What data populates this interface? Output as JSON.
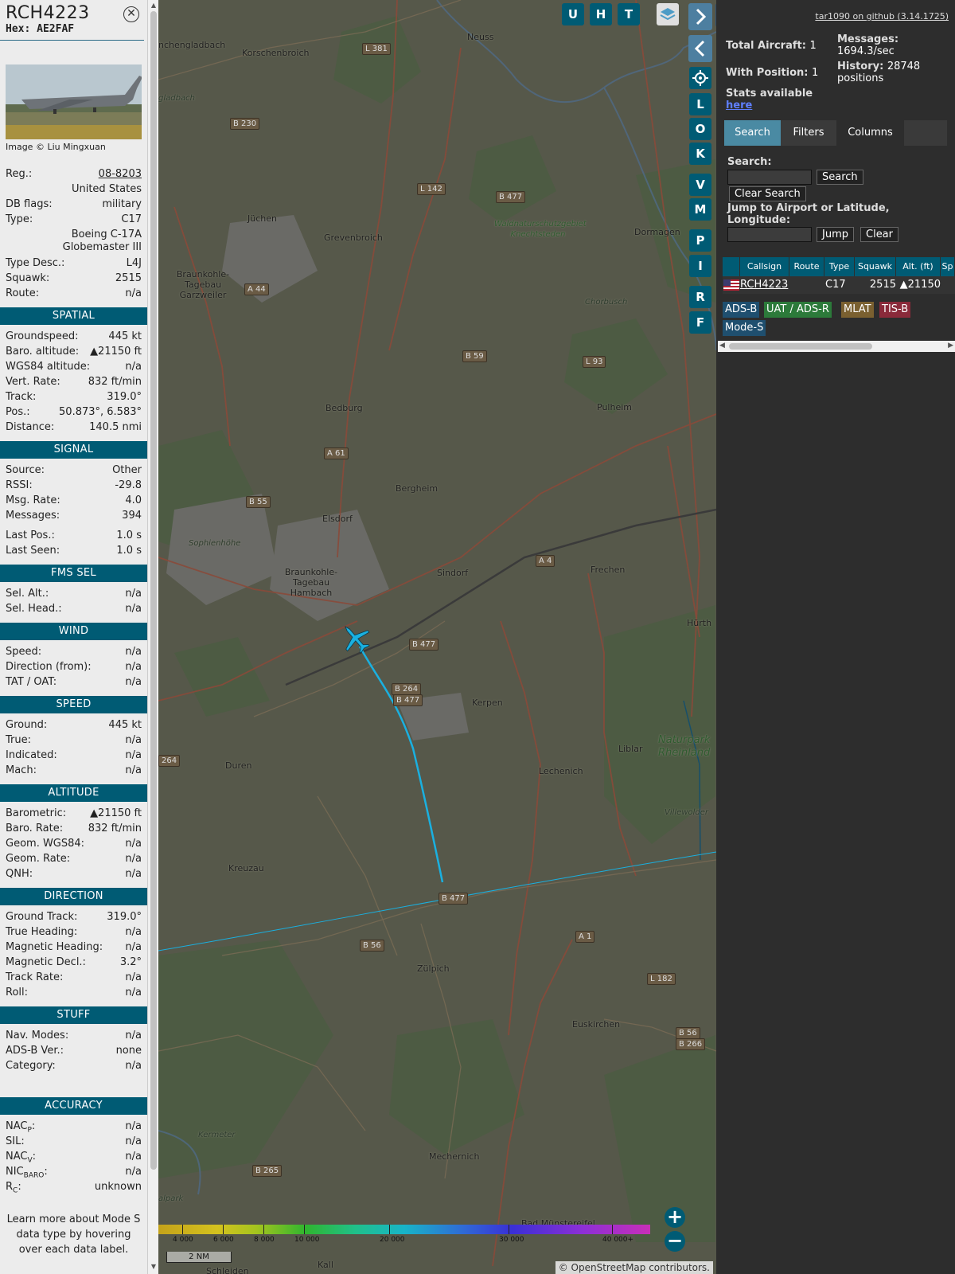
{
  "info": {
    "callsign": "RCH4223",
    "hex": "Hex: AE2FAF",
    "image_credit": "Image © Liu Mingxuan",
    "basic": [
      {
        "k": "Reg.:",
        "v": "08-8203",
        "link": true
      },
      {
        "k": "",
        "v": "United States"
      },
      {
        "k": "DB flags:",
        "v": "military"
      },
      {
        "k": "Type:",
        "v": "C17"
      },
      {
        "k": "",
        "v": "Boeing C-17A Globemaster III",
        "multi": true
      },
      {
        "k": "Type Desc.:",
        "v": "L4J"
      },
      {
        "k": "Squawk:",
        "v": "2515"
      },
      {
        "k": "Route:",
        "v": "n/a"
      }
    ],
    "sections": [
      {
        "title": "SPATIAL",
        "rows": [
          {
            "k": "Groundspeed:",
            "v": "445 kt"
          },
          {
            "k": "Baro. altitude:",
            "v": "▲21150 ft"
          },
          {
            "k": "WGS84 altitude:",
            "v": "n/a"
          },
          {
            "k": "Vert. Rate:",
            "v": "832 ft/min"
          },
          {
            "k": "Track:",
            "v": "319.0°"
          },
          {
            "k": "Pos.:",
            "v": "50.873°, 6.583°"
          },
          {
            "k": "Distance:",
            "v": "140.5 nmi"
          }
        ]
      },
      {
        "title": "SIGNAL",
        "rows": [
          {
            "k": "Source:",
            "v": "Other"
          },
          {
            "k": "RSSI:",
            "v": "-29.8"
          },
          {
            "k": "Msg. Rate:",
            "v": "4.0"
          },
          {
            "k": "Messages:",
            "v": "394"
          },
          {
            "k": "Last Pos.:",
            "v": "1.0 s",
            "gap": true
          },
          {
            "k": "Last Seen:",
            "v": "1.0 s"
          }
        ]
      },
      {
        "title": "FMS SEL",
        "rows": [
          {
            "k": "Sel. Alt.:",
            "v": "n/a"
          },
          {
            "k": "Sel. Head.:",
            "v": "n/a"
          }
        ]
      },
      {
        "title": "WIND",
        "rows": [
          {
            "k": "Speed:",
            "v": "n/a"
          },
          {
            "k": "Direction (from):",
            "v": "n/a"
          },
          {
            "k": "TAT / OAT:",
            "v": "n/a"
          }
        ]
      },
      {
        "title": "SPEED",
        "rows": [
          {
            "k": "Ground:",
            "v": "445 kt"
          },
          {
            "k": "True:",
            "v": "n/a"
          },
          {
            "k": "Indicated:",
            "v": "n/a"
          },
          {
            "k": "Mach:",
            "v": "n/a"
          }
        ]
      },
      {
        "title": "ALTITUDE",
        "rows": [
          {
            "k": "Barometric:",
            "v": "▲21150 ft"
          },
          {
            "k": "Baro. Rate:",
            "v": "832 ft/min"
          },
          {
            "k": "Geom. WGS84:",
            "v": "n/a"
          },
          {
            "k": "Geom. Rate:",
            "v": "n/a"
          },
          {
            "k": "QNH:",
            "v": "n/a"
          }
        ]
      },
      {
        "title": "DIRECTION",
        "rows": [
          {
            "k": "Ground Track:",
            "v": "319.0°"
          },
          {
            "k": "True Heading:",
            "v": "n/a"
          },
          {
            "k": "Magnetic Heading:",
            "v": "n/a"
          },
          {
            "k": "Magnetic Decl.:",
            "v": "3.2°"
          },
          {
            "k": "Track Rate:",
            "v": "n/a"
          },
          {
            "k": "Roll:",
            "v": "n/a"
          }
        ]
      },
      {
        "title": "STUFF",
        "rows": [
          {
            "k": "Nav. Modes:",
            "v": "n/a"
          },
          {
            "k": "ADS-B Ver.:",
            "v": "none"
          },
          {
            "k": "Category:",
            "v": "n/a"
          }
        ]
      },
      {
        "title": "ACCURACY",
        "gap_before": true,
        "rows": [
          {
            "k": "NAC",
            "sub": "P",
            "v": "n/a"
          },
          {
            "k": "SIL:",
            "v": "n/a"
          },
          {
            "k": "NAC",
            "sub": "V",
            "v": "n/a"
          },
          {
            "k": "NIC",
            "sub": "BARO",
            "v": "n/a"
          },
          {
            "k": "R",
            "sub": "C",
            "v": "unknown"
          }
        ]
      }
    ],
    "note": "Learn more about Mode S data type by hovering over each data label."
  },
  "map": {
    "buttons_top": [
      "U",
      "H",
      "T"
    ],
    "buttons_side": [
      "L",
      "O",
      "K",
      "V",
      "M",
      "P",
      "I",
      "R",
      "F"
    ],
    "places": [
      "Neuss",
      "Korschenbroich",
      "nchengladbach",
      "Jüchen",
      "Grevenbroich",
      "Dormagen",
      "Braunkohle-Tagebau Garzweiler",
      "Bedburg",
      "Pulheim",
      "Bergheim",
      "Elsdorf",
      "Sindorf",
      "Frechen",
      "Braunkohle-Tagebau Hambach",
      "Kerpen",
      "Hürth",
      "Liblar",
      "Lechenich",
      "Duren",
      "Kreuzau",
      "Zülpich",
      "Euskirchen",
      "Mechernich",
      "Bad Münstereifel",
      "Kall",
      "Schleiden",
      "Sophienhöhe",
      "Naturpark Rheinland",
      "Villewolder",
      "Kermeter",
      "Waldnaturschutzgebiet Knechtsteden",
      "Chorbusch",
      "gladbach",
      "alpark"
    ],
    "roads": [
      "L 381",
      "B 230",
      "L 142",
      "B 477",
      "A 44",
      "B 59",
      "L 93",
      "A 61",
      "B 55",
      "A 4",
      "B 477",
      "B 264",
      "B 477",
      "264",
      "B 477",
      "B 56",
      "A 1",
      "L 182",
      "B 56",
      "B 266",
      "B 265"
    ],
    "legend": [
      "4 000",
      "6 000",
      "8 000",
      "10 000",
      "20 000",
      "30 000",
      "40 000+"
    ],
    "scale": "2 NM",
    "attribution_brand": "© OpenStreetMap",
    "attribution_tail": " contributors.",
    "zoom_in": "+",
    "zoom_out": "−"
  },
  "right": {
    "github": "tar1090 on github (3.14.1725)",
    "total_aircraft_label": "Total Aircraft:",
    "total_aircraft": "1",
    "with_position_label": "With Position:",
    "with_position": "1",
    "messages_label": "Messages:",
    "messages": "1694.3/sec",
    "history_label": "History:",
    "history": "28748 positions",
    "stats_label": "Stats available",
    "stats_link": "here",
    "tabs": [
      "Search",
      "Filters",
      "Columns"
    ],
    "search_label": "Search:",
    "search_button": "Search",
    "clear_search": "Clear Search",
    "jump_label": "Jump to Airport or Latitude, Longitude:",
    "jump_button": "Jump",
    "clear_button": "Clear",
    "columns": [
      "Callsign",
      "Route",
      "Type",
      "Squawk",
      "Alt. (ft)",
      "Sp"
    ],
    "row": {
      "callsign": "RCH4223",
      "type": "C17",
      "squawk": "2515",
      "alt": "▲21150"
    },
    "badges": [
      "ADS-B",
      "UAT / ADS-R",
      "MLAT",
      "TIS-B",
      "Mode-S"
    ]
  },
  "colors": {
    "accent": "#005b74",
    "track": "#1ab0e0",
    "adsb": "#1f4f6f",
    "uat": "#2c7a3a",
    "mlat": "#7a6030",
    "tisb": "#8a2a3a"
  }
}
